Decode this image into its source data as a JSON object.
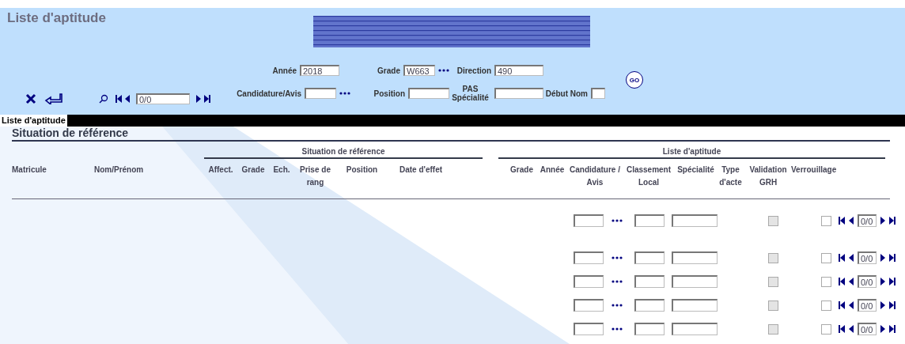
{
  "window": {
    "title": "Liste d'aptitude"
  },
  "toolbar": {
    "pager": "0/0"
  },
  "filters": [
    {
      "label": "Année",
      "value": "2018",
      "lookup": false
    },
    {
      "label": "Grade",
      "value": "W663",
      "lookup": true
    },
    {
      "label": "Direction",
      "value": "490",
      "lookup": false
    },
    {
      "label": "Candidature/Avis",
      "lookup": true
    },
    {
      "label": "Position",
      "lookup": false
    },
    {
      "label": "PAS Spécialité",
      "lookup": false
    },
    {
      "label": "Début Nom",
      "lookup": false
    }
  ],
  "go_button": "GO",
  "tabs": [
    {
      "label": "Liste d'aptitude",
      "selected": true
    }
  ],
  "section": {
    "title": "Situation de référence"
  },
  "table": {
    "groups": [
      {
        "label": "Situation de référence"
      },
      {
        "label": "Liste d'aptitude"
      }
    ],
    "columns": [
      "Matricule",
      "Nom/Prénom",
      "Affect.",
      "Grade",
      "Ech.",
      "Prise de rang",
      "Position",
      "Date d'effet",
      "Grade",
      "Année",
      "Candidature / Avis",
      "Classement Local",
      "Spécialité",
      "Type d'acte",
      "Validation GRH",
      "Verrouillage"
    ],
    "rows": [
      {
        "validation_grh": {
          "checked": false,
          "disabled": true
        },
        "verrouillage": {
          "checked": false
        },
        "pager": "0/0"
      },
      {
        "validation_grh": {
          "checked": false,
          "disabled": true
        },
        "verrouillage": {
          "checked": false
        },
        "pager": "0/0"
      },
      {
        "validation_grh": {
          "checked": false,
          "disabled": true
        },
        "verrouillage": {
          "checked": false
        },
        "pager": "0/0"
      },
      {
        "validation_grh": {
          "checked": false,
          "disabled": true
        },
        "verrouillage": {
          "checked": false
        },
        "pager": "0/0"
      },
      {
        "validation_grh": {
          "checked": false,
          "disabled": true
        },
        "verrouillage": {
          "checked": false
        },
        "pager": "0/0"
      }
    ]
  }
}
